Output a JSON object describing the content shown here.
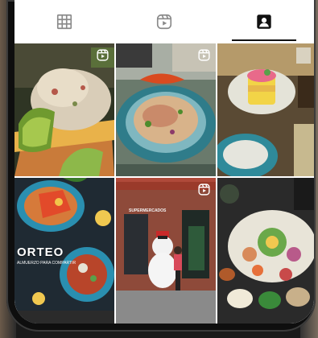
{
  "profile_tabs": [
    {
      "name": "tab-grid",
      "icon": "grid-icon",
      "selected": false
    },
    {
      "name": "tab-reels",
      "icon": "reels-icon",
      "selected": false
    },
    {
      "name": "tab-tagged",
      "icon": "tagged-person-icon",
      "selected": true
    }
  ],
  "posts": [
    {
      "content": "ceviche-with-avocado",
      "reel": true
    },
    {
      "content": "ceviche-plate-with-peppers",
      "reel": true
    },
    {
      "content": "causa-and-drinks",
      "reel": false
    },
    {
      "content": "ceviche-platters-with-logo",
      "reel": false,
      "caption": "ORTEO",
      "subcaption": "ALMUERZO PARA COMPARTIR"
    },
    {
      "content": "storefront-with-snowman",
      "reel": true,
      "sign": "SUPERMERCADOS"
    },
    {
      "content": "seafood-sharing-platter",
      "reel": false
    }
  ],
  "colors": {
    "accent": "#111111",
    "screen": "#ffffff",
    "bezel": "#0e0e0e"
  }
}
